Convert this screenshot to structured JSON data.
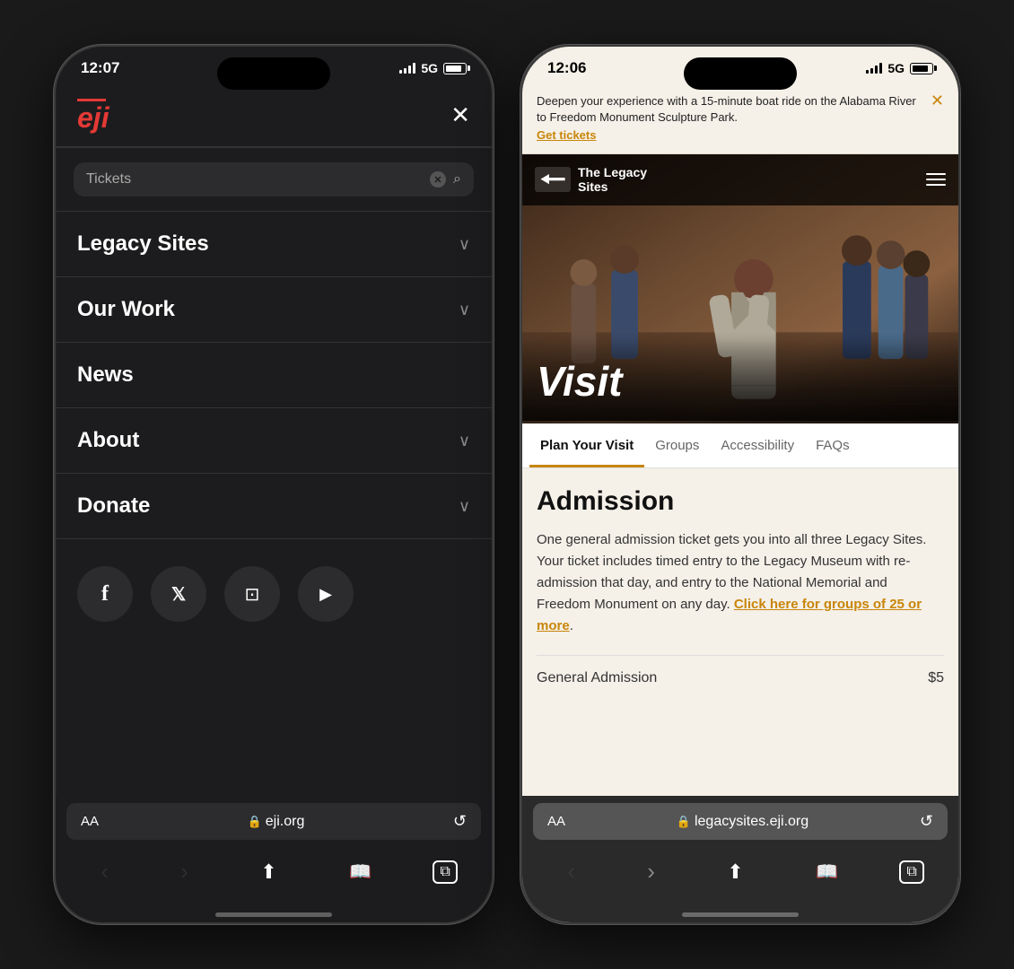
{
  "left_phone": {
    "status": {
      "time": "12:07",
      "network": "5G"
    },
    "search": {
      "placeholder": "Tickets",
      "label": "Search"
    },
    "nav_items": [
      {
        "id": "legacy-sites",
        "label": "Legacy Sites",
        "has_chevron": true
      },
      {
        "id": "our-work",
        "label": "Our Work",
        "has_chevron": true
      },
      {
        "id": "news",
        "label": "News",
        "has_chevron": false
      },
      {
        "id": "about",
        "label": "About",
        "has_chevron": true
      },
      {
        "id": "donate",
        "label": "Donate",
        "has_chevron": true
      }
    ],
    "social": [
      {
        "id": "facebook",
        "icon": "f"
      },
      {
        "id": "twitter",
        "icon": "𝕏"
      },
      {
        "id": "instagram",
        "icon": "◎"
      },
      {
        "id": "youtube",
        "icon": "▶"
      }
    ],
    "url_bar": {
      "aa": "AA",
      "url": "eji.org",
      "reload": "↺"
    },
    "close_btn": "✕"
  },
  "right_phone": {
    "status": {
      "time": "12:06",
      "network": "5G"
    },
    "banner": {
      "text": "Deepen your experience with a 15-minute boat ride on the Alabama River to Freedom Monument Sculpture Park.",
      "link": "Get tickets",
      "close": "✕"
    },
    "site_header": {
      "logo_text_line1": "The Legacy",
      "logo_text_line2": "Sites",
      "visit_label": "Visit"
    },
    "nav_tabs": [
      {
        "id": "plan-your-visit",
        "label": "Plan Your Visit",
        "active": true
      },
      {
        "id": "groups",
        "label": "Groups",
        "active": false
      },
      {
        "id": "accessibility",
        "label": "Accessibility",
        "active": false
      },
      {
        "id": "faqs",
        "label": "FAQs",
        "active": false
      }
    ],
    "content": {
      "admission_title": "Admission",
      "admission_text": "One general admission ticket gets you into all three Legacy Sites. Your ticket includes timed entry to the Legacy Museum with re-admission that day, and entry to the National Memorial and Freedom Monument on any day.",
      "admission_link": "Click here for groups of 25 or more",
      "admission_link_suffix": ".",
      "general_admission_label": "General Admission",
      "general_admission_price": "$5"
    },
    "url_bar": {
      "aa": "AA",
      "url": "legacysites.eji.org",
      "reload": "↺"
    }
  },
  "icons": {
    "search": "🔍",
    "clear": "✕",
    "chevron_down": "∨",
    "back": "‹",
    "forward": "›",
    "share": "↑",
    "bookmarks": "□",
    "tabs": "⧉",
    "lock": "🔒"
  }
}
